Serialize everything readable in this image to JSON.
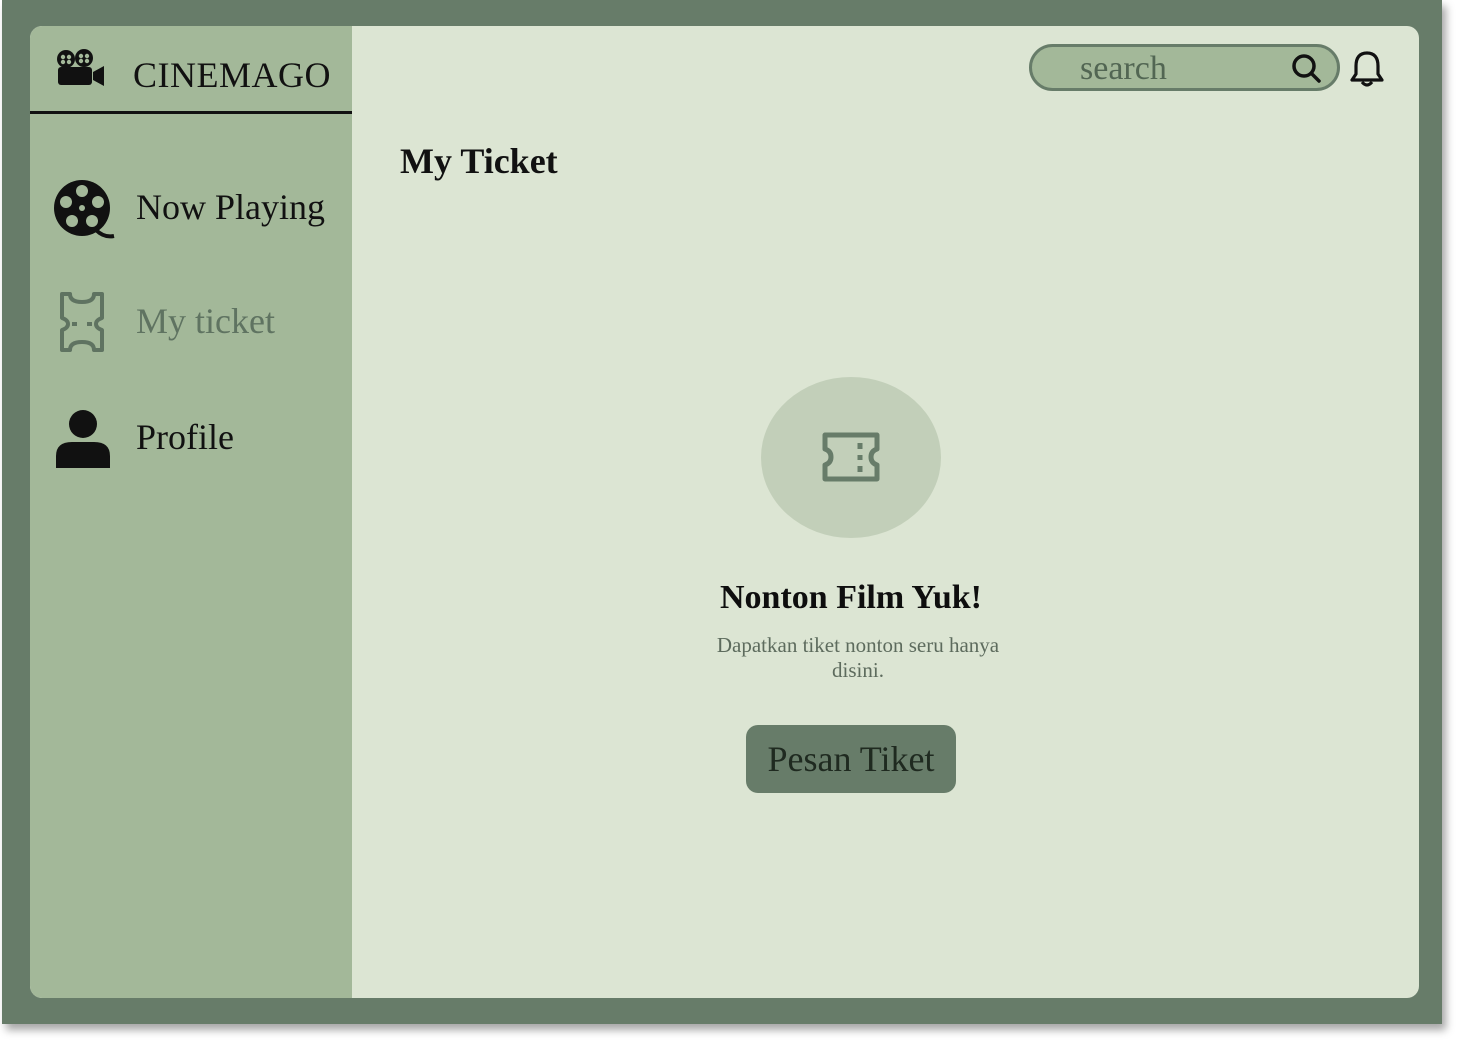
{
  "brand": {
    "name": "CINEMAGO",
    "icon": "movie-camera-icon"
  },
  "sidebar": {
    "items": [
      {
        "label": "Now Playing",
        "icon": "film-reel-icon",
        "active": false
      },
      {
        "label": "My ticket",
        "icon": "ticket-icon",
        "active": true
      },
      {
        "label": "Profile",
        "icon": "user-icon",
        "active": false
      }
    ]
  },
  "header": {
    "search_placeholder": "search",
    "search_icon": "search-icon",
    "notification_icon": "bell-icon"
  },
  "main": {
    "title": "My Ticket",
    "empty_state": {
      "icon": "ticket-icon",
      "heading": "Nonton Film Yuk!",
      "message": "Dapatkan tiket nonton seru hanya disini.",
      "button_label": "Pesan Tiket"
    }
  },
  "colors": {
    "frame": "#677c69",
    "background": "#dce5d3",
    "sidebar": "#a3b899",
    "muted_text": "#5f7361",
    "empty_circle": "#c2cfb9",
    "button": "#677c69"
  }
}
